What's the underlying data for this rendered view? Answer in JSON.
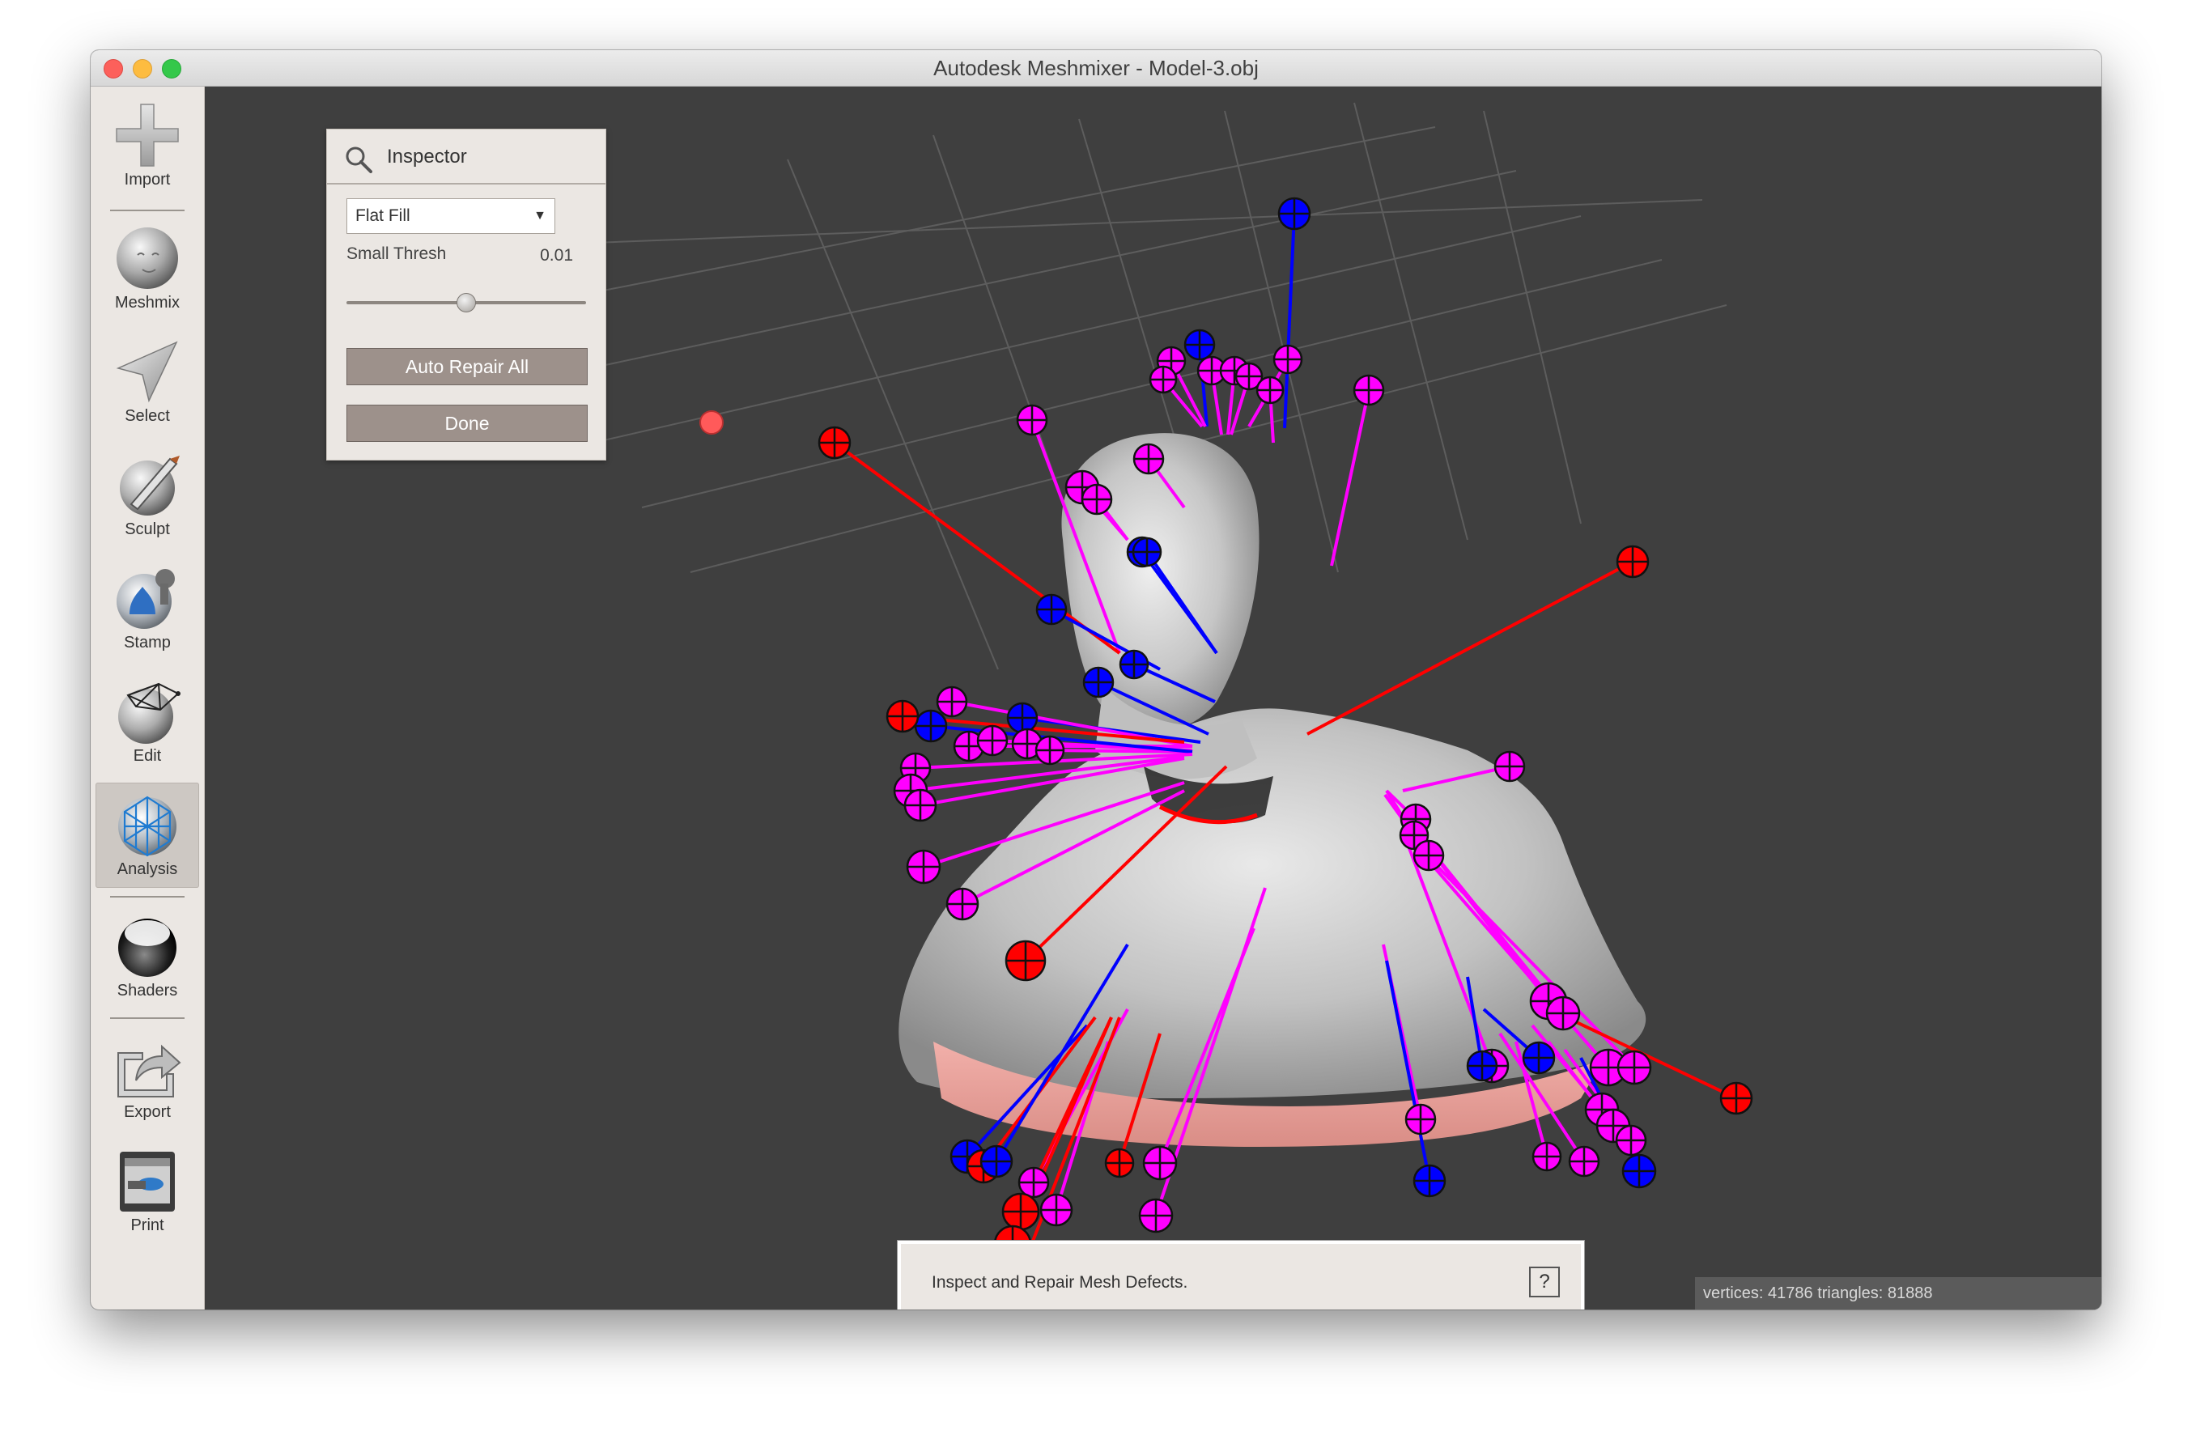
{
  "window": {
    "title": "Autodesk Meshmixer - Model-3.obj"
  },
  "toolbar": {
    "items": [
      {
        "label": "Import",
        "icon": "plus-icon"
      },
      {
        "label": "Meshmix",
        "icon": "meshmix-head-icon"
      },
      {
        "label": "Select",
        "icon": "arrow-cursor-icon"
      },
      {
        "label": "Sculpt",
        "icon": "brush-icon"
      },
      {
        "label": "Stamp",
        "icon": "stamp-icon"
      },
      {
        "label": "Edit",
        "icon": "edit-mesh-icon"
      },
      {
        "label": "Analysis",
        "icon": "analysis-sphere-icon",
        "active": true
      },
      {
        "label": "Shaders",
        "icon": "shader-sphere-icon"
      },
      {
        "label": "Export",
        "icon": "export-icon"
      },
      {
        "label": "Print",
        "icon": "printer-icon"
      }
    ]
  },
  "inspector": {
    "title": "Inspector",
    "fill_mode": "Flat Fill",
    "threshold_label": "Small Thresh",
    "threshold_value": "0.01",
    "slider_fraction": 0.5,
    "auto_repair_label": "Auto Repair All",
    "done_label": "Done"
  },
  "hint": {
    "text": "Inspect and Repair Mesh Defects.",
    "help_label": "?"
  },
  "status": {
    "text": "vertices: 41786 triangles: 81888"
  },
  "colors": {
    "viewport_bg": "#3f3f3f",
    "defect_red": "#ff0000",
    "defect_blue": "#0000ff",
    "defect_magenta": "#ff00ff",
    "toolbar_bg": "#ebe7e3"
  }
}
